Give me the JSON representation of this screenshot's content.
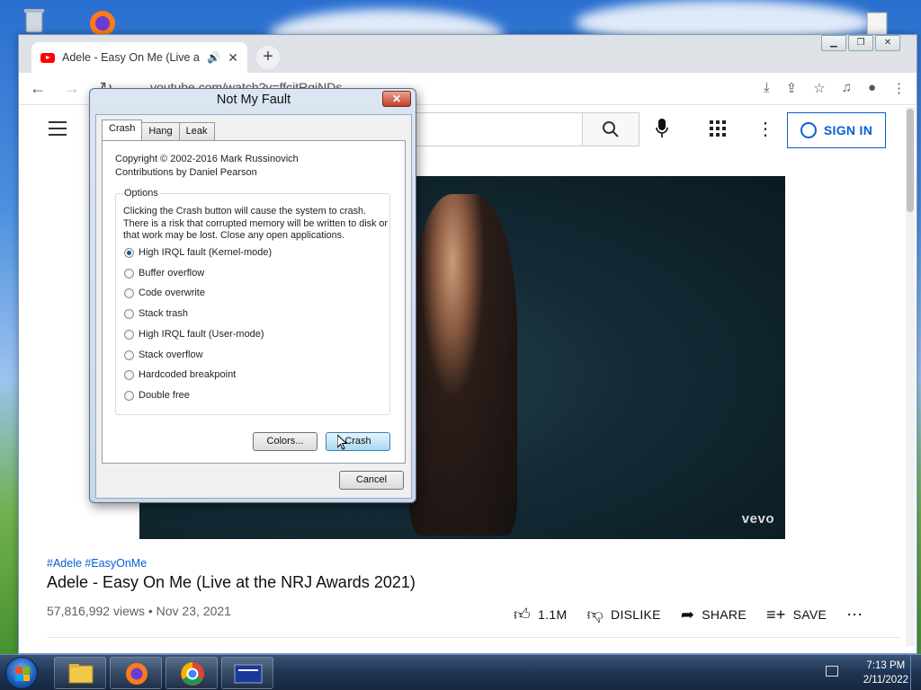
{
  "browser": {
    "tab_title": "Adele - Easy On Me (Live at",
    "tab_audio_icon": "speaker-icon",
    "url": "youtube.com/watch?v=ffcitRgiNDs"
  },
  "youtube": {
    "sign_in": "SIGN IN",
    "hashtags": "#Adele #EasyOnMe",
    "video_title": "Adele - Easy On Me (Live at the NRJ Awards 2021)",
    "views_date": "57,816,992 views • Nov 23, 2021",
    "likes": "1.1M",
    "dislike": "DISLIKE",
    "share": "SHARE",
    "save": "SAVE",
    "vevo": "vevo"
  },
  "dialog": {
    "title": "Not My Fault",
    "tabs": [
      "Crash",
      "Hang",
      "Leak"
    ],
    "active_tab": "Crash",
    "copyright": "Copyright © 2002-2016 Mark Russinovich",
    "contributions": "Contributions by Daniel Pearson",
    "options_label": "Options",
    "description": "Clicking the Crash button will cause the system to crash. There is a risk that corrupted memory will be written to disk or that work may be lost. Close any open applications.",
    "options": [
      {
        "label": "High IRQL fault (Kernel-mode)",
        "checked": true
      },
      {
        "label": "Buffer overflow",
        "checked": false
      },
      {
        "label": "Code overwrite",
        "checked": false
      },
      {
        "label": "Stack trash",
        "checked": false
      },
      {
        "label": "High IRQL fault (User-mode)",
        "checked": false
      },
      {
        "label": "Stack overflow",
        "checked": false
      },
      {
        "label": "Hardcoded breakpoint",
        "checked": false
      },
      {
        "label": "Double free",
        "checked": false
      }
    ],
    "colors_button": "Colors...",
    "crash_button": "Crash",
    "cancel_button": "Cancel"
  },
  "taskbar": {
    "time": "7:13 PM",
    "date": "2/11/2022"
  }
}
